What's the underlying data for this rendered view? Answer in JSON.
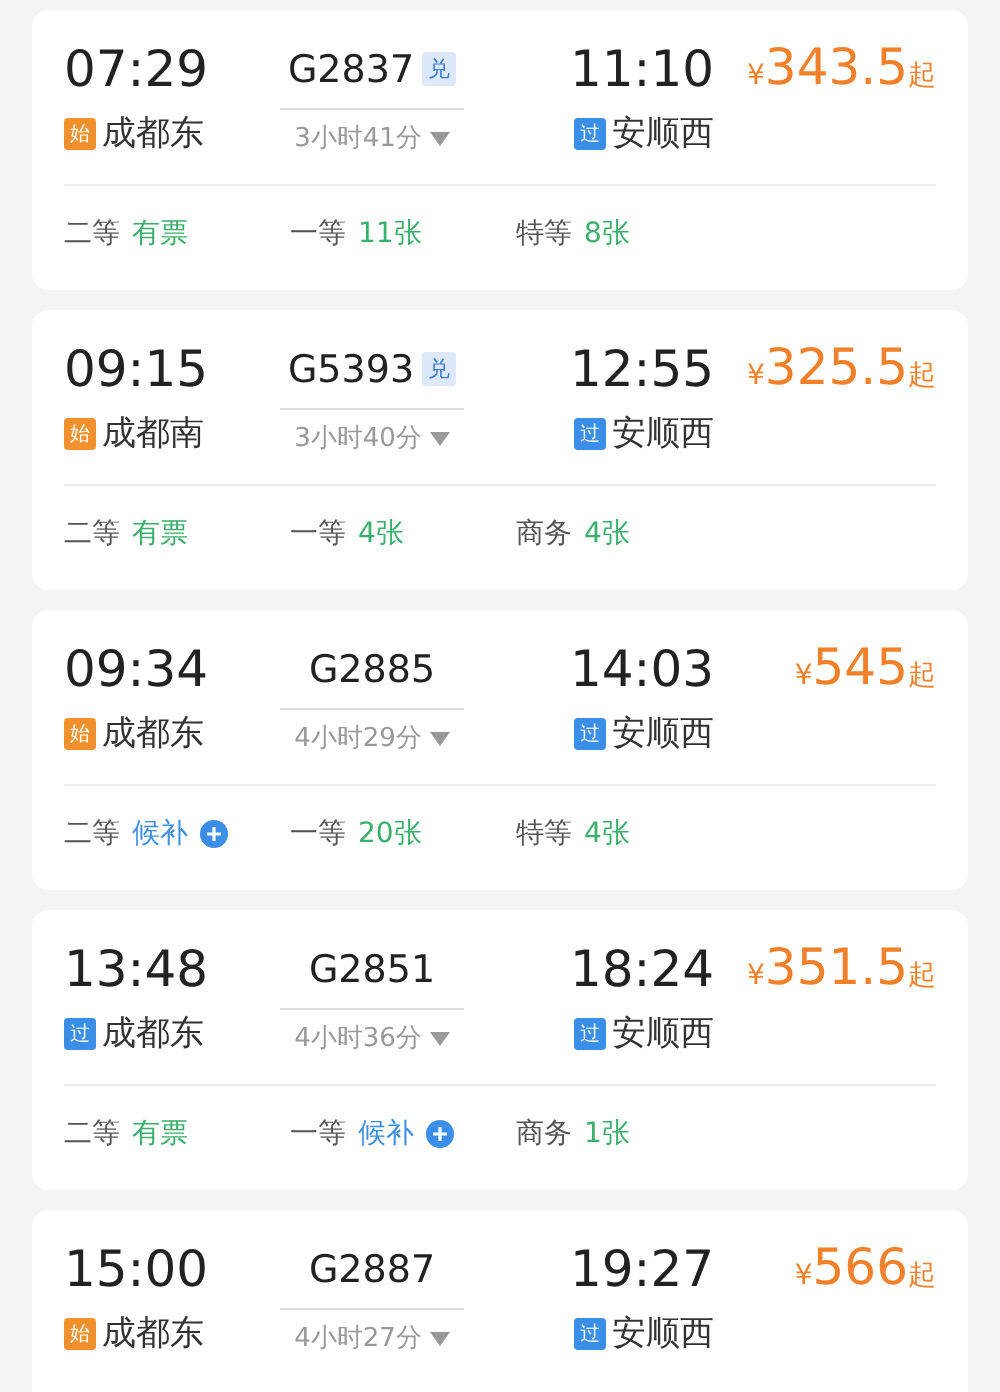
{
  "trains": [
    {
      "depart_time": "07:29",
      "depart_station": {
        "badge": "始",
        "kind": "origin",
        "name": "成都东"
      },
      "train_no": "G2837",
      "exchange_badge": "兑",
      "duration": "3小时41分",
      "arrive_time": "11:10",
      "arrive_station": {
        "badge": "过",
        "kind": "pass",
        "name": "安顺西"
      },
      "price_symbol": "¥",
      "price": "343.5",
      "price_suffix": "起",
      "seats": [
        {
          "class": "二等",
          "status": "有票",
          "kind": "available"
        },
        {
          "class": "一等",
          "status": "11张",
          "kind": "available"
        },
        {
          "class": "特等",
          "status": "8张",
          "kind": "available"
        }
      ]
    },
    {
      "depart_time": "09:15",
      "depart_station": {
        "badge": "始",
        "kind": "origin",
        "name": "成都南"
      },
      "train_no": "G5393",
      "exchange_badge": "兑",
      "duration": "3小时40分",
      "arrive_time": "12:55",
      "arrive_station": {
        "badge": "过",
        "kind": "pass",
        "name": "安顺西"
      },
      "price_symbol": "¥",
      "price": "325.5",
      "price_suffix": "起",
      "seats": [
        {
          "class": "二等",
          "status": "有票",
          "kind": "available"
        },
        {
          "class": "一等",
          "status": "4张",
          "kind": "available"
        },
        {
          "class": "商务",
          "status": "4张",
          "kind": "available"
        }
      ]
    },
    {
      "depart_time": "09:34",
      "depart_station": {
        "badge": "始",
        "kind": "origin",
        "name": "成都东"
      },
      "train_no": "G2885",
      "duration": "4小时29分",
      "arrive_time": "14:03",
      "arrive_station": {
        "badge": "过",
        "kind": "pass",
        "name": "安顺西"
      },
      "price_symbol": "¥",
      "price": "545",
      "price_suffix": "起",
      "seats": [
        {
          "class": "二等",
          "status": "候补",
          "kind": "waitlist"
        },
        {
          "class": "一等",
          "status": "20张",
          "kind": "available"
        },
        {
          "class": "特等",
          "status": "4张",
          "kind": "available"
        }
      ]
    },
    {
      "depart_time": "13:48",
      "depart_station": {
        "badge": "过",
        "kind": "pass",
        "name": "成都东"
      },
      "train_no": "G2851",
      "duration": "4小时36分",
      "arrive_time": "18:24",
      "arrive_station": {
        "badge": "过",
        "kind": "pass",
        "name": "安顺西"
      },
      "price_symbol": "¥",
      "price": "351.5",
      "price_suffix": "起",
      "seats": [
        {
          "class": "二等",
          "status": "有票",
          "kind": "available"
        },
        {
          "class": "一等",
          "status": "候补",
          "kind": "waitlist"
        },
        {
          "class": "商务",
          "status": "1张",
          "kind": "available"
        }
      ]
    },
    {
      "depart_time": "15:00",
      "depart_station": {
        "badge": "始",
        "kind": "origin",
        "name": "成都东"
      },
      "train_no": "G2887",
      "duration": "4小时27分",
      "arrive_time": "19:27",
      "arrive_station": {
        "badge": "过",
        "kind": "pass",
        "name": "安顺西"
      },
      "price_symbol": "¥",
      "price": "566",
      "price_suffix": "起"
    }
  ]
}
